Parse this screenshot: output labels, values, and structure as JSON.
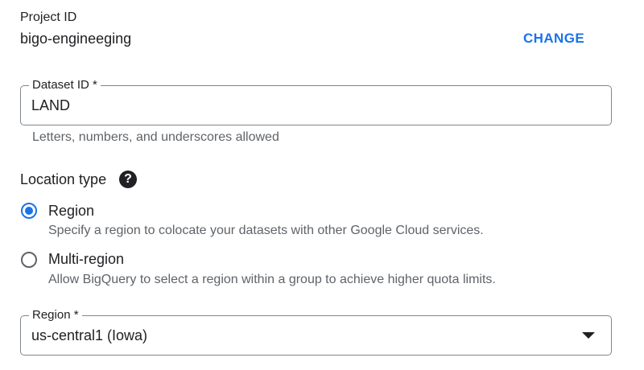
{
  "project": {
    "label": "Project ID",
    "value": "bigo-engineeging",
    "change_label": "CHANGE"
  },
  "dataset": {
    "legend": "Dataset ID *",
    "value": "LAND",
    "hint": "Letters, numbers, and underscores allowed"
  },
  "location": {
    "label": "Location type",
    "help_icon": "help-icon",
    "options": [
      {
        "label": "Region",
        "description": "Specify a region to colocate your datasets with other Google Cloud services.",
        "selected": true
      },
      {
        "label": "Multi-region",
        "description": "Allow BigQuery to select a region within a group to achieve higher quota limits.",
        "selected": false
      }
    ]
  },
  "region": {
    "legend": "Region *",
    "value": "us-central1 (Iowa)"
  },
  "colors": {
    "accent": "#1a73e8",
    "text": "#202124",
    "secondary_text": "#5f6368",
    "border": "#80868b"
  }
}
